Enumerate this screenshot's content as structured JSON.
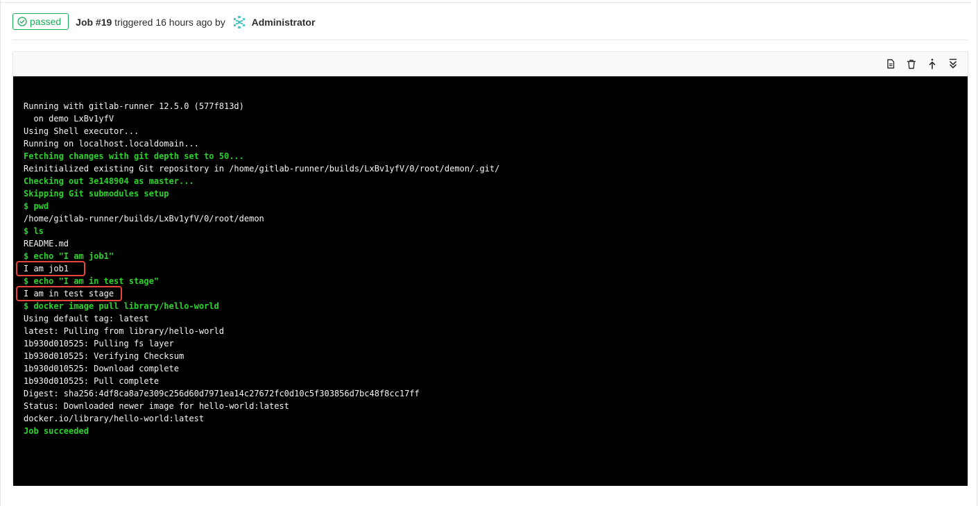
{
  "status": {
    "label": "passed",
    "icon": "status-success-icon",
    "color": "#1aaa55"
  },
  "job": {
    "id": "Job #19",
    "triggered_text": " triggered 16 hours ago by ",
    "user": "Administrator",
    "avatar_icon": "identicon-avatar"
  },
  "toolbar": {
    "buttons": [
      {
        "name": "show-raw-log-icon"
      },
      {
        "name": "erase-log-icon"
      },
      {
        "name": "scroll-to-top-icon"
      },
      {
        "name": "scroll-to-bottom-icon"
      }
    ]
  },
  "log": {
    "lines": [
      {
        "text": "Running with gitlab-runner 12.5.0 (577f813d)",
        "style": "normal"
      },
      {
        "text": "  on demo LxBv1yfV",
        "style": "normal"
      },
      {
        "text": "Using Shell executor...",
        "style": "normal"
      },
      {
        "text": "Running on localhost.localdomain...",
        "style": "normal"
      },
      {
        "text": "Fetching changes with git depth set to 50...",
        "style": "green"
      },
      {
        "text": "Reinitialized existing Git repository in /home/gitlab-runner/builds/LxBv1yfV/0/root/demon/.git/",
        "style": "normal"
      },
      {
        "text": "Checking out 3e148904 as master...",
        "style": "green"
      },
      {
        "text": "Skipping Git submodules setup",
        "style": "green"
      },
      {
        "text": "$ pwd",
        "style": "green"
      },
      {
        "text": "/home/gitlab-runner/builds/LxBv1yfV/0/root/demon",
        "style": "normal"
      },
      {
        "text": "$ ls",
        "style": "green"
      },
      {
        "text": "README.md",
        "style": "normal"
      },
      {
        "text": "$ echo \"I am job1\"",
        "style": "green"
      },
      {
        "text": "I am job1",
        "style": "normal"
      },
      {
        "text": "$ echo \"I am in test stage\"",
        "style": "green"
      },
      {
        "text": "I am in test stage",
        "style": "normal"
      },
      {
        "text": "$ docker image pull library/hello-world",
        "style": "green"
      },
      {
        "text": "Using default tag: latest",
        "style": "normal"
      },
      {
        "text": "latest: Pulling from library/hello-world",
        "style": "normal"
      },
      {
        "text": "1b930d010525: Pulling fs layer",
        "style": "normal"
      },
      {
        "text": "1b930d010525: Verifying Checksum",
        "style": "normal"
      },
      {
        "text": "1b930d010525: Download complete",
        "style": "normal"
      },
      {
        "text": "1b930d010525: Pull complete",
        "style": "normal"
      },
      {
        "text": "Digest: sha256:4df8ca8a7e309c256d60d7971ea14c27672fc0d10c5f303856d7bc48f8cc17ff",
        "style": "normal"
      },
      {
        "text": "Status: Downloaded newer image for hello-world:latest",
        "style": "normal"
      },
      {
        "text": "docker.io/library/hello-world:latest",
        "style": "normal"
      },
      {
        "text": "Job succeeded",
        "style": "green"
      }
    ]
  },
  "colors": {
    "success_green": "#1aaa55",
    "log_green": "#2cd32c",
    "highlight_red": "#e7443a",
    "log_bg": "#000000"
  }
}
